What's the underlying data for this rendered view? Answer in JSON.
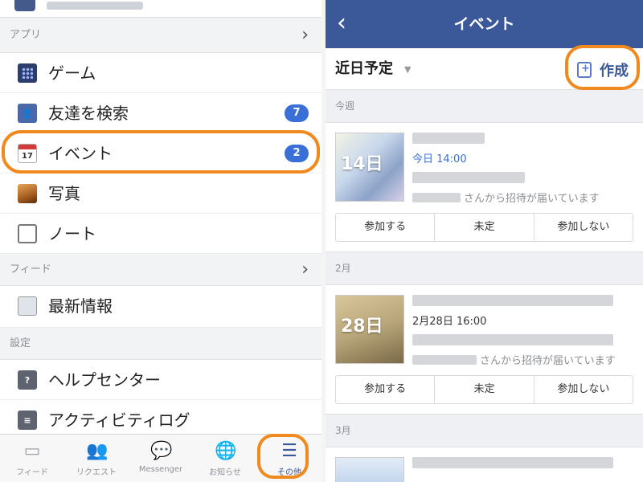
{
  "left": {
    "sections": {
      "apps": "アプリ",
      "feed": "フィード",
      "settings": "設定"
    },
    "apps_items": [
      {
        "label": "ゲーム",
        "icon": "game-icon"
      },
      {
        "label": "友達を検索",
        "icon": "find-friends-icon",
        "badge": "7"
      },
      {
        "label": "イベント",
        "icon": "calendar-icon",
        "icon_text": "17",
        "badge": "2"
      },
      {
        "label": "写真",
        "icon": "photo-icon"
      },
      {
        "label": "ノート",
        "icon": "note-icon"
      }
    ],
    "feed_items": [
      {
        "label": "最新情報",
        "icon": "news-feed-icon"
      }
    ],
    "settings_items": [
      {
        "label": "ヘルプセンター",
        "icon": "help-icon",
        "icon_text": "?"
      },
      {
        "label": "アクティビティログ",
        "icon": "activity-log-icon"
      }
    ],
    "tabs": [
      {
        "label": "フィード",
        "icon": "feed-icon",
        "glyph": "▭"
      },
      {
        "label": "リクエスト",
        "icon": "friend-requests-icon",
        "glyph": "👥"
      },
      {
        "label": "Messenger",
        "icon": "messenger-icon",
        "glyph": "💬"
      },
      {
        "label": "お知らせ",
        "icon": "notifications-icon",
        "glyph": "🌐"
      },
      {
        "label": "その他",
        "icon": "more-menu-icon",
        "glyph": "☰",
        "active": true
      }
    ]
  },
  "right": {
    "title": "イベント",
    "filter_label": "近日予定",
    "create_label": "作成",
    "groups": [
      {
        "header": "今週",
        "events": [
          {
            "day": "14日",
            "time": "今日 14:00",
            "invite_suffix": "さんから招待が届いています"
          }
        ]
      },
      {
        "header": "2月",
        "events": [
          {
            "day": "28日",
            "time": "2月28日 16:00",
            "invite_suffix": "さんから招待が届いています"
          }
        ]
      },
      {
        "header": "3月",
        "events": []
      }
    ],
    "rsvp": {
      "going": "参加する",
      "maybe": "未定",
      "decline": "参加しない"
    }
  },
  "colors": {
    "brand": "#3b5998",
    "badge": "#3a6fd8",
    "highlight": "#f08a1e"
  }
}
